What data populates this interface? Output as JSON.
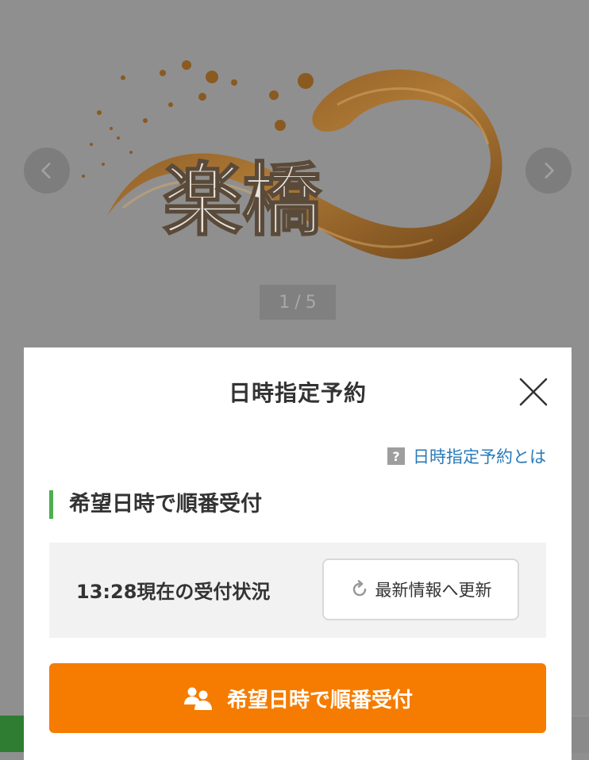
{
  "carousel": {
    "page_current": "1",
    "page_separator": "/",
    "page_total": "5",
    "logo_text": "楽橋"
  },
  "modal": {
    "title": "日時指定予約",
    "help_link": "日時指定予約とは",
    "help_icon_glyph": "?",
    "section_heading": "希望日時で順番受付",
    "status_text": "13:28現在の受付状況",
    "refresh_label": "最新情報へ更新",
    "primary_button_label": "希望日時で順番受付"
  },
  "colors": {
    "accent_orange": "#f57c00",
    "heading_bar_green": "#4caf50",
    "link_blue": "#2a7ab8"
  }
}
